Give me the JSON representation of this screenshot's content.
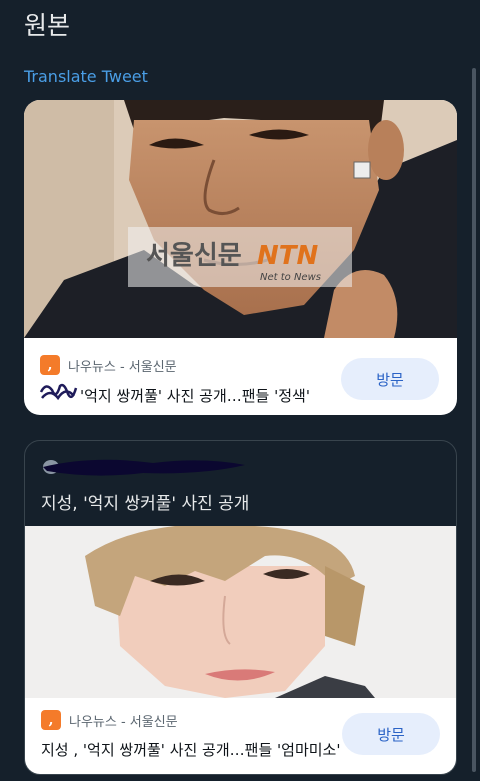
{
  "header": {
    "title": "원본",
    "translate_link": "Translate Tweet"
  },
  "card1": {
    "image_watermark": "서울신문",
    "image_watermark_brand": "NTN",
    "image_watermark_sub": "Net to News",
    "source": "나우뉴스 - 서울신문",
    "headline": "'억지 쌍꺼풀' 사진 공개…팬들 '정색'",
    "visit_label": "방문"
  },
  "card2": {
    "title": "지성, '억지 쌍커풀' 사진 공개",
    "source": "나우뉴스 - 서울신문",
    "headline": "지성 , '억지 쌍꺼풀' 사진 공개…팬들 '엄마미소'",
    "visit_label": "방문"
  },
  "colors": {
    "background": "#15202b",
    "link": "#4a9ee6",
    "visit_button": "#e6eefc",
    "source_logo": "#f47b2a"
  }
}
